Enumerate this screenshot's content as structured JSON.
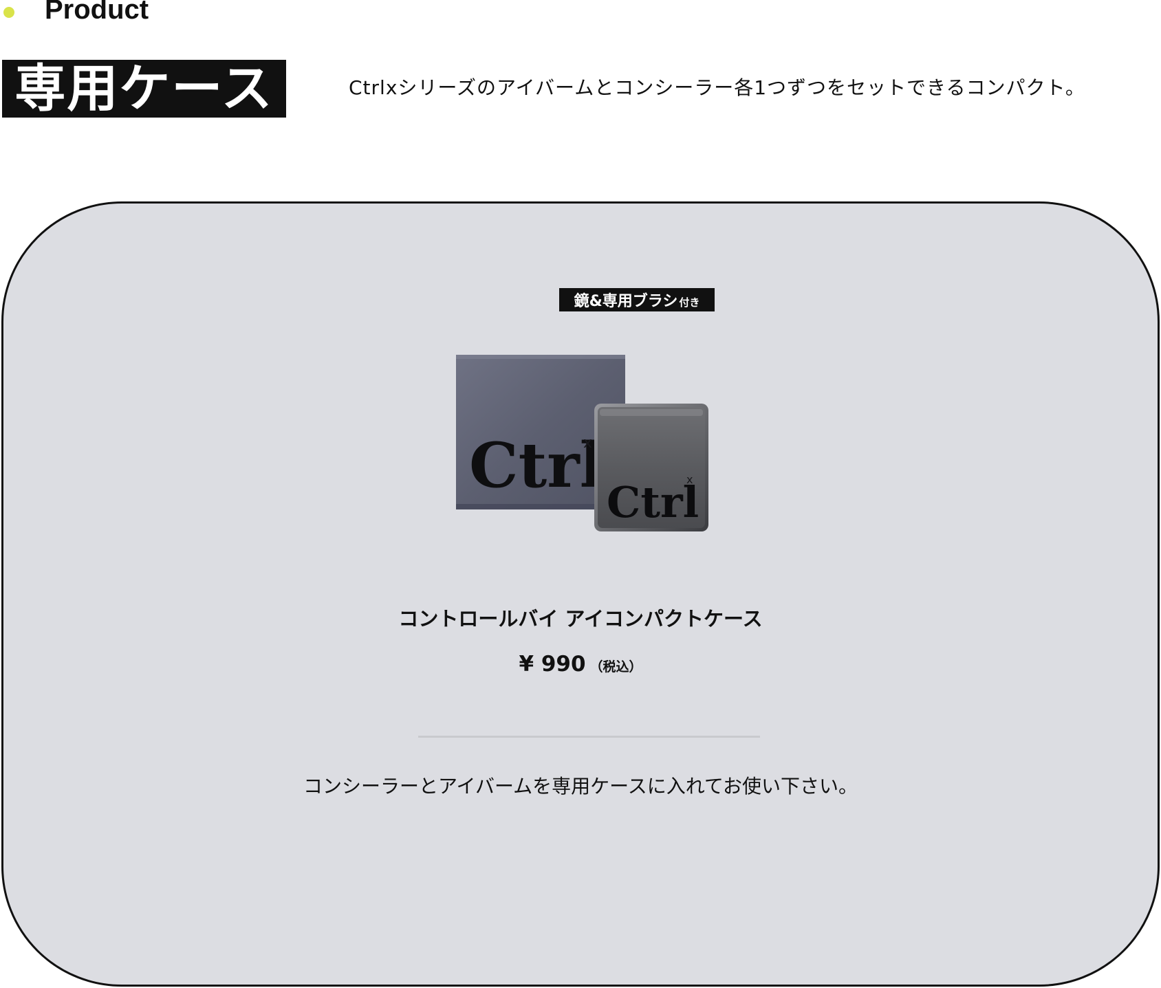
{
  "header": {
    "section_label": "Product",
    "heading": "専用ケース",
    "description": "Ctrlxシリーズのアイバームとコンシーラー各1つずつをセットできるコンパクト。"
  },
  "product": {
    "badge_main": "鏡&専用ブラシ",
    "badge_sub": "付き",
    "image_text_box": "Ctrl",
    "image_text_box_sup": "x",
    "image_text_compact": "Ctrl",
    "image_text_compact_sup": "x",
    "name": "コントロールバイ アイコンパクトケース",
    "price": "¥ 990",
    "price_tax_note": "（税込）",
    "usage_note": "コンシーラーとアイバームを専用ケースに入れてお使い下さい。"
  },
  "colors": {
    "accent_dot": "#d9e34a",
    "card_background": "#dcdde2",
    "text": "#111111"
  }
}
